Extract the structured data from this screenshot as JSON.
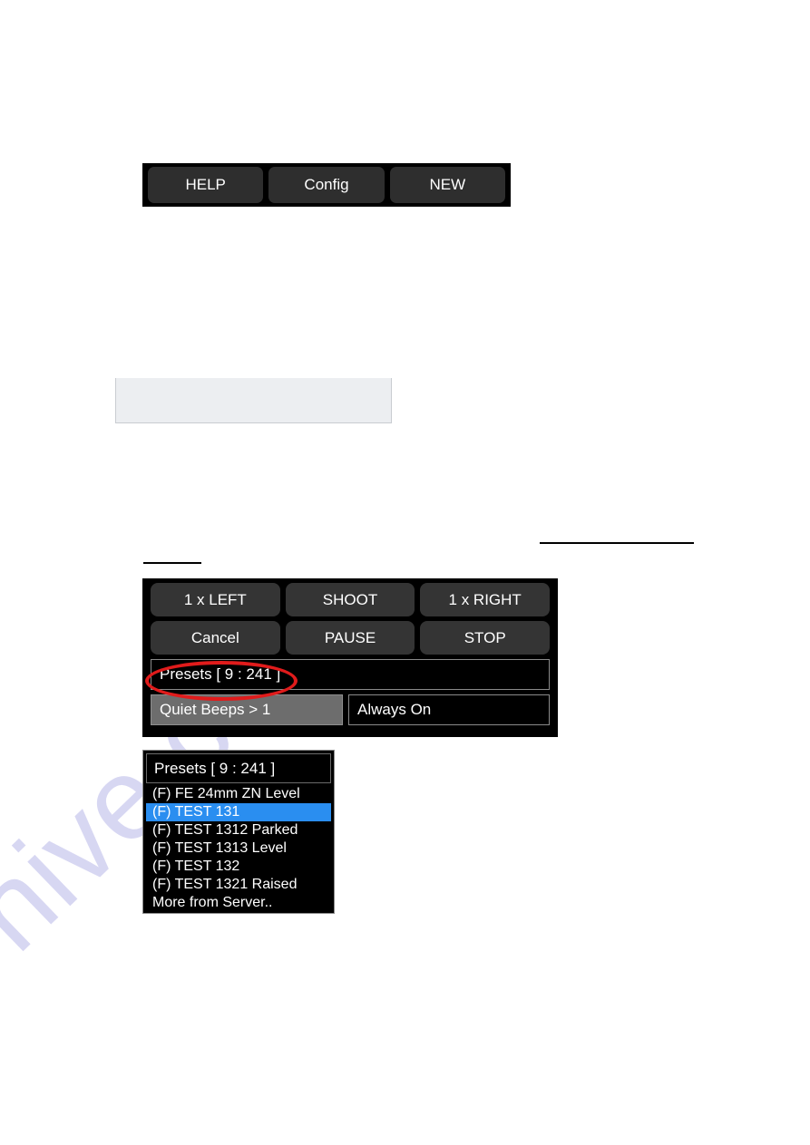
{
  "watermark": {
    "text": "hive.com"
  },
  "top_toolbar": {
    "buttons": [
      {
        "label": "HELP",
        "name": "help-button"
      },
      {
        "label": "Config",
        "name": "config-button"
      },
      {
        "label": "NEW",
        "name": "new-button"
      }
    ]
  },
  "blank_panel": {
    "header_text": "",
    "body_text": ""
  },
  "control_panel": {
    "row1": [
      {
        "label": "1 x LEFT",
        "name": "one-x-left-button"
      },
      {
        "label": "SHOOT",
        "name": "shoot-button"
      },
      {
        "label": "1 x RIGHT",
        "name": "one-x-right-button"
      }
    ],
    "row2": [
      {
        "label": "Cancel",
        "name": "cancel-button"
      },
      {
        "label": "PAUSE",
        "name": "pause-button"
      },
      {
        "label": "STOP",
        "name": "stop-button"
      }
    ],
    "presets_field": "Presets [ 9 : 241 ]",
    "quiet_beeps_field": "Quiet Beeps > 1",
    "always_on_field": "Always On"
  },
  "presets_dropdown": {
    "header": "Presets [ 9 : 241 ]",
    "items": [
      {
        "label": "(F) FE 24mm ZN Level",
        "selected": false
      },
      {
        "label": "(F) TEST 131",
        "selected": true
      },
      {
        "label": "(F) TEST 1312 Parked",
        "selected": false
      },
      {
        "label": "(F) TEST 1313 Level",
        "selected": false
      },
      {
        "label": "(F) TEST 132",
        "selected": false
      },
      {
        "label": "(F) TEST 1321 Raised",
        "selected": false
      },
      {
        "label": "More from Server..",
        "selected": false
      }
    ]
  },
  "colors": {
    "panel_background": "#000000",
    "button_face": "#343434",
    "toolbar_button_face": "#2e2e2e",
    "highlight_blue": "#2a8ef0",
    "annotation_red": "#e01b1b",
    "field_border": "#8a8a8a",
    "quiet_beeps_face": "#6d6d6d",
    "blank_panel_body": "#eceef1",
    "blank_panel_header": "#262626",
    "watermark": "#c9c8ee"
  }
}
